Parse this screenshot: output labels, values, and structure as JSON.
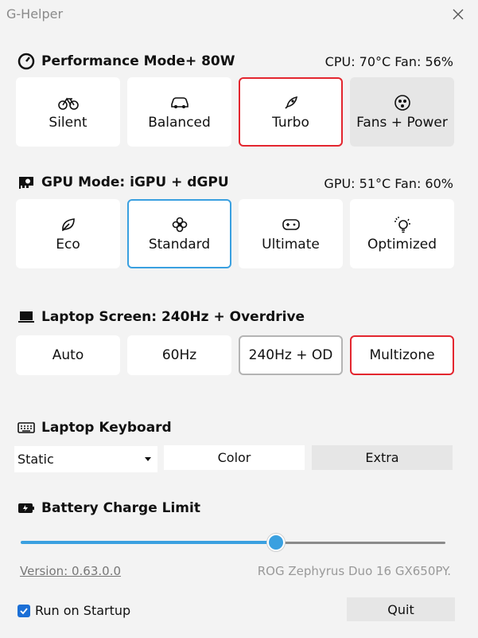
{
  "window": {
    "title": "G-Helper"
  },
  "performance": {
    "title": "Performance Mode+ 80W",
    "status": "CPU: 70°C  Fan: 56%",
    "modes": [
      {
        "label": "Silent",
        "icon": "bicycle-icon"
      },
      {
        "label": "Balanced",
        "icon": "car-icon"
      },
      {
        "label": "Turbo",
        "icon": "rocket-icon",
        "selected": true
      },
      {
        "label": "Fans + Power",
        "icon": "fan-settings-icon"
      }
    ]
  },
  "gpu": {
    "title": "GPU Mode: iGPU + dGPU",
    "status": "GPU: 51°C  Fan: 60%",
    "modes": [
      {
        "label": "Eco",
        "icon": "leaf-icon"
      },
      {
        "label": "Standard",
        "icon": "flower-icon",
        "selected": true
      },
      {
        "label": "Ultimate",
        "icon": "gamepad-icon"
      },
      {
        "label": "Optimized",
        "icon": "sparkle-bulb-icon"
      }
    ]
  },
  "screen": {
    "title": "Laptop Screen: 240Hz + Overdrive",
    "modes": [
      {
        "label": "Auto"
      },
      {
        "label": "60Hz"
      },
      {
        "label": "240Hz + OD",
        "selected": true
      },
      {
        "label": "Multizone",
        "highlighted": true
      }
    ]
  },
  "keyboard": {
    "title": "Laptop Keyboard",
    "mode_value": "Static",
    "color_label": "Color",
    "extra_label": "Extra"
  },
  "battery": {
    "title": "Battery Charge Limit",
    "slider_fraction": 0.6
  },
  "footer": {
    "version": "Version: 0.63.0.0",
    "model": "ROG Zephyrus Duo 16 GX650PY.",
    "run_on_startup_label": "Run on Startup",
    "run_on_startup_checked": true,
    "quit_label": "Quit"
  },
  "colors": {
    "accent_blue": "#3aa0e0",
    "accent_red": "#e3262f",
    "checkbox": "#1b6fd6"
  }
}
